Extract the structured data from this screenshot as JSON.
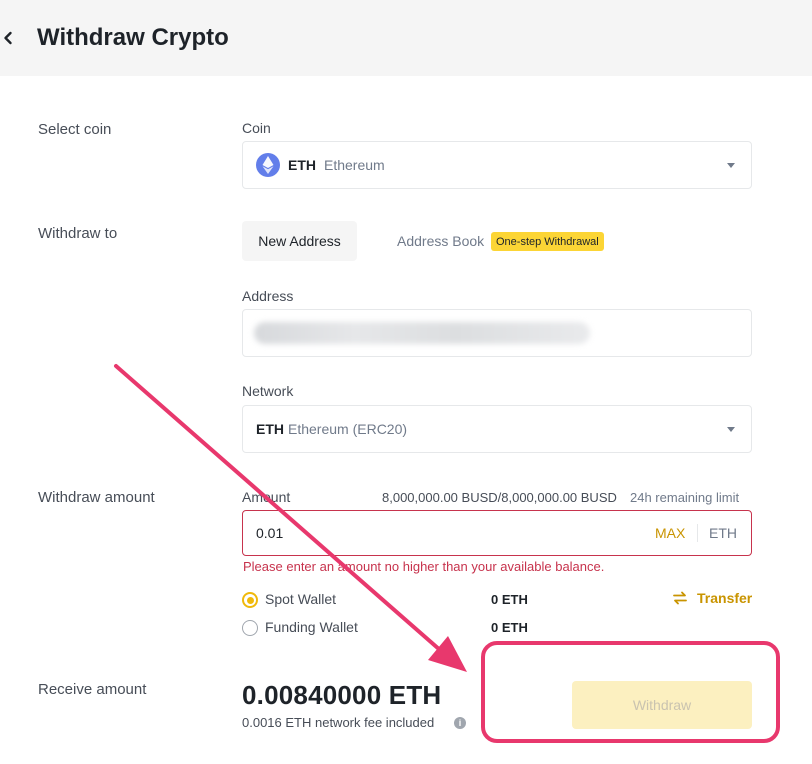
{
  "header": {
    "title": "Withdraw Crypto"
  },
  "rows": {
    "select_coin": "Select coin",
    "withdraw_to": "Withdraw to",
    "withdraw_amount": "Withdraw amount",
    "receive_amount": "Receive amount"
  },
  "coin": {
    "label": "Coin",
    "symbol": "ETH",
    "name": "Ethereum"
  },
  "destination": {
    "tab_new": "New Address",
    "tab_book": "Address Book",
    "badge": "One-step Withdrawal",
    "address_label": "Address"
  },
  "network": {
    "label": "Network",
    "symbol": "ETH",
    "name": "Ethereum (ERC20)"
  },
  "amount": {
    "label": "Amount",
    "limit": "8,000,000.00 BUSD/8,000,000.00 BUSD",
    "limit_label": "24h remaining limit",
    "value": "0.01",
    "max": "MAX",
    "unit": "ETH",
    "error": "Please enter an amount no higher than your available balance."
  },
  "wallets": {
    "spot_label": "Spot Wallet",
    "spot_balance": "0 ETH",
    "funding_label": "Funding Wallet",
    "funding_balance": "0 ETH",
    "transfer": "Transfer"
  },
  "receive": {
    "amount": "0.00840000 ETH",
    "fee": "0.0016 ETH network fee included"
  },
  "actions": {
    "withdraw": "Withdraw"
  },
  "colors": {
    "accent": "#f0b90b",
    "error": "#c7334d",
    "annotation": "#e8386d",
    "eth": "#627eea"
  }
}
